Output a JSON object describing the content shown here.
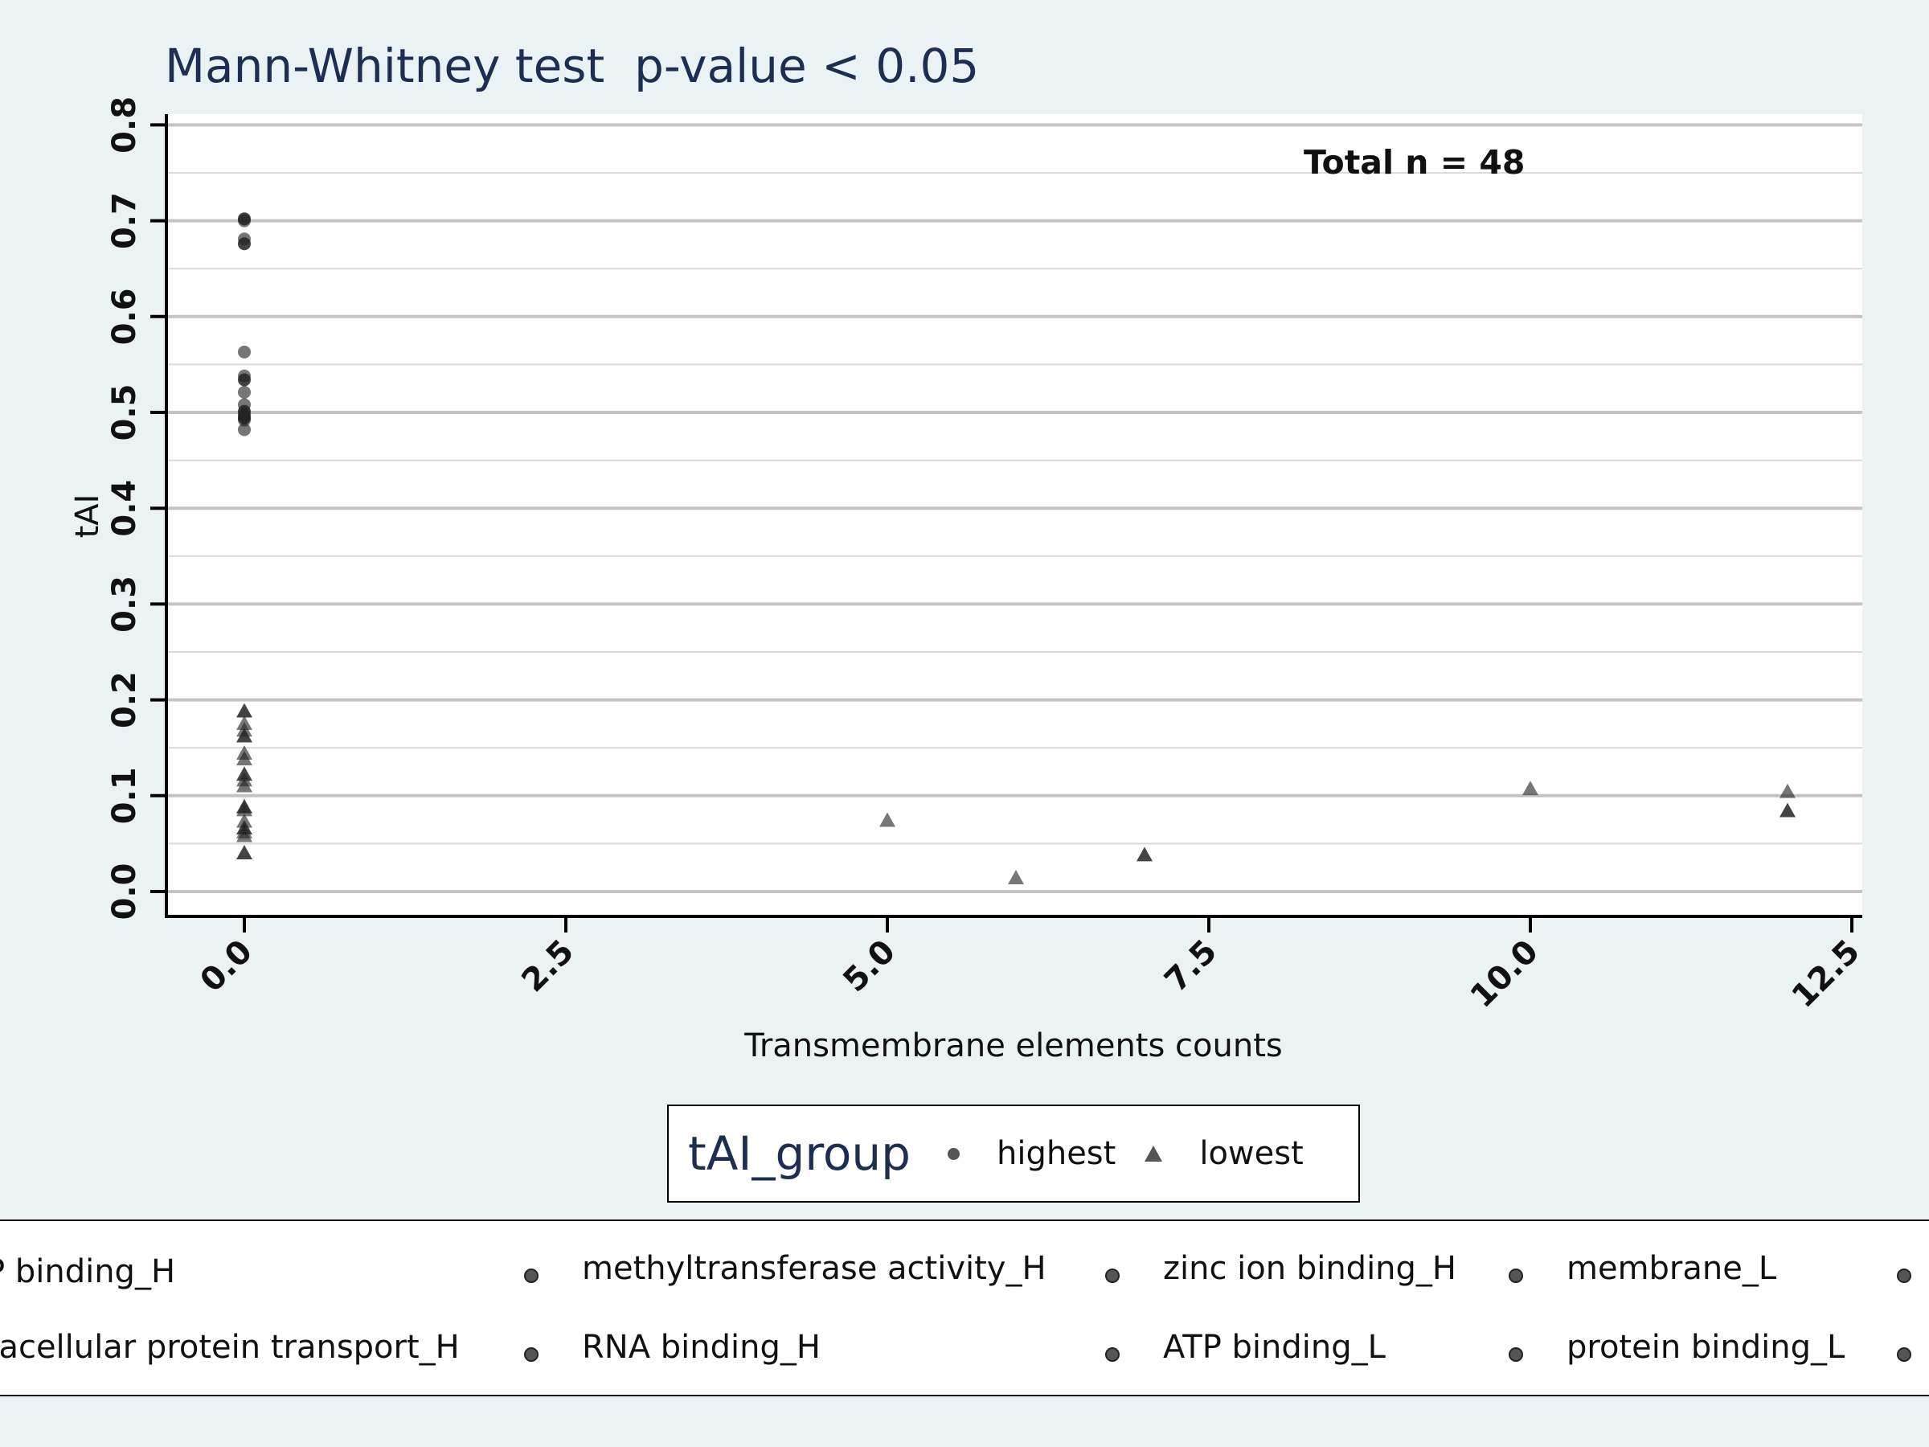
{
  "chart_data": {
    "type": "scatter",
    "title": "Mann-Whitney test  p-value < 0.05",
    "xlabel": "Transmembrane elements counts",
    "ylabel": "tAI",
    "annotation": "Total n = 48",
    "xlim": [
      -0.3,
      12.5
    ],
    "ylim": [
      -0.025,
      0.81
    ],
    "x_ticks": [
      "0.0",
      "2.5",
      "5.0",
      "7.5",
      "10.0",
      "12.5"
    ],
    "y_ticks": [
      "0.0",
      "0.1",
      "0.2",
      "0.3",
      "0.4",
      "0.5",
      "0.6",
      "0.7",
      "0.8"
    ],
    "grid": true,
    "series": [
      {
        "name": "highest",
        "marker": "circle",
        "points": [
          [
            0,
            0.702
          ],
          [
            0,
            0.7
          ],
          [
            0,
            0.681
          ],
          [
            0,
            0.676
          ],
          [
            0,
            0.563
          ],
          [
            0,
            0.538
          ],
          [
            0,
            0.534
          ],
          [
            0,
            0.521
          ],
          [
            0,
            0.508
          ],
          [
            0,
            0.501
          ],
          [
            0,
            0.498
          ],
          [
            0,
            0.496
          ],
          [
            0,
            0.494
          ],
          [
            0,
            0.492
          ],
          [
            0,
            0.482
          ]
        ]
      },
      {
        "name": "lowest",
        "marker": "triangle",
        "points": [
          [
            0,
            0.188
          ],
          [
            0,
            0.175
          ],
          [
            0,
            0.168
          ],
          [
            0,
            0.162
          ],
          [
            0,
            0.144
          ],
          [
            0,
            0.138
          ],
          [
            0,
            0.122
          ],
          [
            0,
            0.116
          ],
          [
            0,
            0.11
          ],
          [
            0,
            0.088
          ],
          [
            0,
            0.085
          ],
          [
            0,
            0.073
          ],
          [
            0,
            0.066
          ],
          [
            0,
            0.062
          ],
          [
            0,
            0.058
          ],
          [
            0,
            0.04
          ],
          [
            5,
            0.074
          ],
          [
            6,
            0.014
          ],
          [
            7,
            0.038
          ],
          [
            10,
            0.107
          ],
          [
            12,
            0.104
          ],
          [
            12,
            0.084
          ]
        ]
      }
    ]
  },
  "legend": {
    "title": "tAI_group",
    "entries": [
      {
        "label": "highest",
        "marker": "circle"
      },
      {
        "label": "lowest",
        "marker": "triangle"
      }
    ]
  },
  "go_legend": {
    "items": [
      {
        "label": "P binding_H"
      },
      {
        "label": "methyltransferase activity_H"
      },
      {
        "label": "zinc ion binding_H"
      },
      {
        "label": "membrane_L"
      },
      {
        "label": "racellular protein transport_H"
      },
      {
        "label": "RNA binding_H"
      },
      {
        "label": "ATP binding_L"
      },
      {
        "label": "protein binding_L"
      }
    ]
  }
}
